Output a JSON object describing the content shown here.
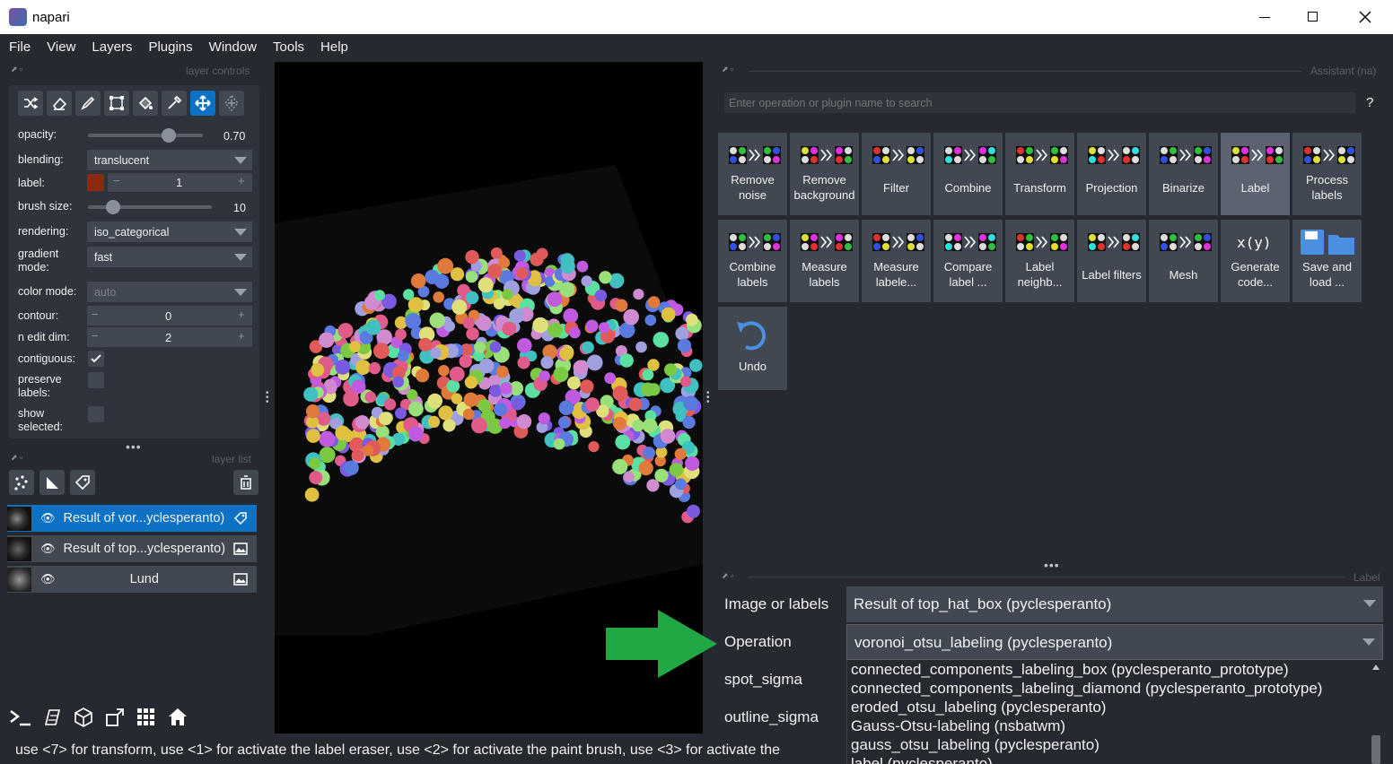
{
  "window": {
    "title": "napari"
  },
  "menubar": {
    "items": [
      "File",
      "View",
      "Layers",
      "Plugins",
      "Window",
      "Tools",
      "Help"
    ]
  },
  "layer_controls": {
    "title": "layer controls",
    "opacity_label": "opacity:",
    "opacity_value": "0.70",
    "opacity_fraction": 0.7,
    "blending_label": "blending:",
    "blending_value": "translucent",
    "label_label": "label:",
    "label_value": "1",
    "label_color": "#8b2a10",
    "brush_label": "brush size:",
    "brush_value": "10",
    "brush_fraction": 0.2,
    "rendering_label": "rendering:",
    "rendering_value": "iso_categorical",
    "gradient_label": "gradient\nmode:",
    "gradient_value": "fast",
    "colormode_label": "color mode:",
    "colormode_value": "auto",
    "contour_label": "contour:",
    "contour_value": "0",
    "nedit_label": "n edit dim:",
    "nedit_value": "2",
    "contiguous_label": "contiguous:",
    "contiguous_checked": true,
    "preserve_label": "preserve\nlabels:",
    "preserve_checked": false,
    "show_label": "show\nselected:",
    "show_checked": false,
    "stepper_minus": "−",
    "stepper_plus": "+"
  },
  "layer_list": {
    "title": "layer list",
    "layers": [
      {
        "name": "Result of vor...yclesperanto)",
        "selected": true,
        "type_icon": "labels-icon"
      },
      {
        "name": "Result of top...yclesperanto)",
        "selected": false,
        "type_icon": "image-icon"
      },
      {
        "name": "Lund",
        "selected": false,
        "type_icon": "image-icon"
      }
    ]
  },
  "assistant": {
    "title": "Assistant (na)",
    "search_placeholder": "Enter operation or plugin name to search",
    "help": "?",
    "tiles_row1": [
      "Remove\nnoise",
      "Remove\nbackground",
      "Filter",
      "Combine",
      "Transform",
      "Projection",
      "Binarize",
      "Label",
      "Process\nlabels"
    ],
    "tiles_row2": [
      "Combine\nlabels",
      "Measure\nlabels",
      "Measure\nlabele...",
      "Compare\nlabel ...",
      "Label\nneighb...",
      "Label filters",
      "Mesh",
      "Generate\ncode...",
      "Save and\nload ..."
    ],
    "tiles_row3": [
      "Undo"
    ],
    "selected_tile": "Label",
    "xy_text": "x(y)"
  },
  "label_panel": {
    "title": "Label",
    "image_label": "Image or labels",
    "image_value": "Result of top_hat_box (pyclesperanto)",
    "operation_label": "Operation",
    "operation_value": "voronoi_otsu_labeling (pyclesperanto)",
    "spot_label": "spot_sigma",
    "outline_label": "outline_sigma",
    "options": [
      "connected_components_labeling_box (pyclesperanto_prototype)",
      "connected_components_labeling_diamond (pyclesperanto_prototype)",
      "eroded_otsu_labeling (pyclesperanto)",
      "Gauss-Otsu-labeling (nsbatwm)",
      "gauss_otsu_labeling (pyclesperanto)",
      "label (pyclesperanto)"
    ]
  },
  "status": {
    "text": "use <7> for transform, use <1> for activate the label eraser, use <2> for activate the paint brush, use <3> for activate the"
  },
  "colors": {
    "accent": "#0d72c4",
    "arrow": "#1fa843",
    "panel": "#414851",
    "background": "#262930"
  }
}
